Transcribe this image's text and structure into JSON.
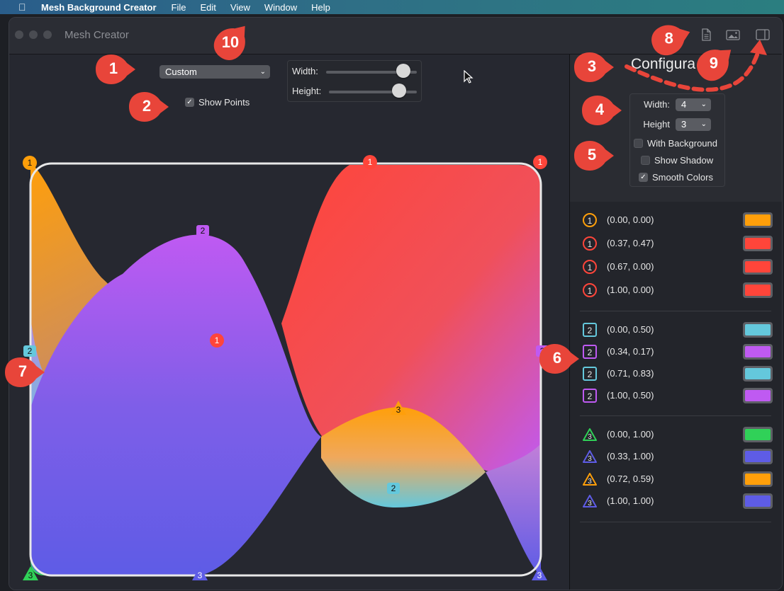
{
  "menubar": {
    "app_name": "Mesh Background Creator",
    "items": [
      "File",
      "Edit",
      "View",
      "Window",
      "Help"
    ]
  },
  "window": {
    "title": "Mesh Creator"
  },
  "toolbar": {
    "icons": [
      "document-icon",
      "image-icon",
      "sidebar-toggle-icon"
    ]
  },
  "controls": {
    "preset_value": "Custom",
    "show_points_label": "Show Points",
    "show_points_checked": true,
    "width_label": "Width:",
    "height_label": "Height:",
    "width_slider_value": 0.85,
    "height_slider_value": 0.8
  },
  "sidebar": {
    "title": "Configura",
    "width_label": "Width:",
    "width_value": "4",
    "height_label": "Height",
    "height_value": "3",
    "with_background_label": "With Background",
    "with_background_checked": false,
    "show_shadow_label": "Show Shadow",
    "show_shadow_checked": false,
    "smooth_colors_label": "Smooth Colors",
    "smooth_colors_checked": true
  },
  "point_groups": [
    {
      "points": [
        {
          "badge": "1",
          "shape": "circle",
          "coord": "(0.00, 0.00)",
          "color": "#FF9F0A"
        },
        {
          "badge": "1",
          "shape": "circle",
          "coord": "(0.37, 0.47)",
          "color": "#FF453A"
        },
        {
          "badge": "1",
          "shape": "circle",
          "coord": "(0.67, 0.00)",
          "color": "#FF453A"
        },
        {
          "badge": "1",
          "shape": "circle",
          "coord": "(1.00, 0.00)",
          "color": "#FF453A"
        }
      ]
    },
    {
      "points": [
        {
          "badge": "2",
          "shape": "square",
          "coord": "(0.00, 0.50)",
          "color": "#64C8DC"
        },
        {
          "badge": "2",
          "shape": "square",
          "coord": "(0.34, 0.17)",
          "color": "#BF5AF2"
        },
        {
          "badge": "2",
          "shape": "square",
          "coord": "(0.71, 0.83)",
          "color": "#64C8DC"
        },
        {
          "badge": "2",
          "shape": "square",
          "coord": "(1.00, 0.50)",
          "color": "#BF5AF2"
        }
      ]
    },
    {
      "points": [
        {
          "badge": "3",
          "shape": "triangle",
          "coord": "(0.00, 1.00)",
          "color": "#30D158"
        },
        {
          "badge": "3",
          "shape": "triangle",
          "coord": "(0.33, 1.00)",
          "color": "#5E5CE6"
        },
        {
          "badge": "3",
          "shape": "triangle",
          "coord": "(0.72, 0.59)",
          "color": "#FF9F0A"
        },
        {
          "badge": "3",
          "shape": "triangle",
          "coord": "(1.00, 1.00)",
          "color": "#5E5CE6"
        }
      ]
    }
  ],
  "canvas_points": [
    {
      "label": "1",
      "shape": "circle",
      "color": "#FF9F0A"
    },
    {
      "label": "1",
      "shape": "circle",
      "color": "#FF453A"
    },
    {
      "label": "1",
      "shape": "circle",
      "color": "#FF453A"
    },
    {
      "label": "1",
      "shape": "circle",
      "color": "#FF453A"
    },
    {
      "label": "2",
      "shape": "square",
      "color": "#64C8DC"
    },
    {
      "label": "2",
      "shape": "square",
      "color": "#BF5AF2"
    },
    {
      "label": "2",
      "shape": "square",
      "color": "#64C8DC"
    },
    {
      "label": "2",
      "shape": "square",
      "color": "#BF5AF2"
    },
    {
      "label": "3",
      "shape": "triangle",
      "color": "#30D158"
    },
    {
      "label": "3",
      "shape": "triangle",
      "color": "#5E5CE6"
    },
    {
      "label": "3",
      "shape": "triangle",
      "color": "#FF9F0A"
    },
    {
      "label": "3",
      "shape": "triangle",
      "color": "#5E5CE6"
    }
  ],
  "callouts": [
    "1",
    "2",
    "3",
    "4",
    "5",
    "6",
    "7",
    "8",
    "9",
    "10"
  ],
  "colors": {
    "accent_red": "#F24A3C",
    "orange": "#FF9F0A",
    "red": "#FF453A",
    "cyan": "#64C8DC",
    "purple": "#BF5AF2",
    "green": "#30D158",
    "indigo": "#5E5CE6"
  }
}
